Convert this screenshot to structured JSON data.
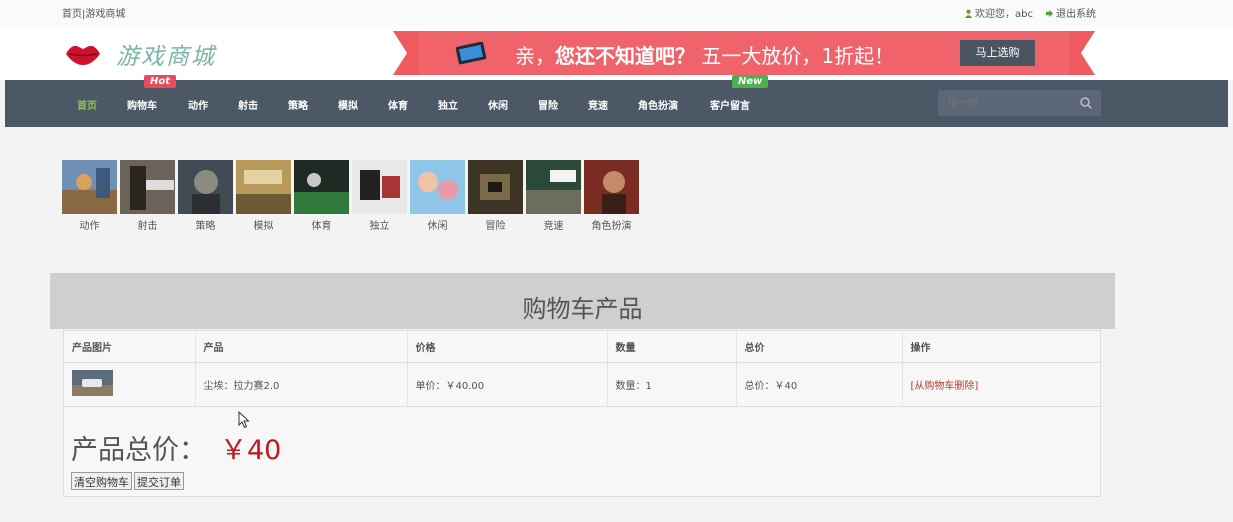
{
  "topbar": {
    "breadcrumb_home": "首页",
    "breadcrumb_sep": "|",
    "breadcrumb_current": "游戏商城",
    "welcome": "欢迎您，abc",
    "logout": "退出系统"
  },
  "header": {
    "logo_text": "游戏商城",
    "promo": {
      "text_prefix": "亲，",
      "text_bold": "您还不知道吧？",
      "text_rest": "五一大放价，1折起！",
      "button": "马上选购"
    }
  },
  "nav": {
    "items": [
      "首页",
      "购物车",
      "动作",
      "射击",
      "策略",
      "模拟",
      "体育",
      "独立",
      "休闲",
      "冒险",
      "竞速",
      "角色扮演",
      "客户留言"
    ],
    "active_index": 0,
    "badge_hot": "Hot",
    "badge_new": "New",
    "search_placeholder": "搜一搜"
  },
  "categories": [
    "动作",
    "射击",
    "策略",
    "模拟",
    "体育",
    "独立",
    "休闲",
    "冒险",
    "竞速",
    "角色扮演"
  ],
  "cart": {
    "title": "购物车产品",
    "headers": [
      "产品图片",
      "产品",
      "价格",
      "数量",
      "总价",
      "操作"
    ],
    "rows": [
      {
        "product": "尘埃：拉力赛2.0",
        "price": "单价：￥40.00",
        "quantity": "数量：1",
        "total": "总价：￥40",
        "action": "[从购物车删除]"
      }
    ],
    "total_label": "产品总价：",
    "total_value": "￥40",
    "clear_button": "清空购物车",
    "submit_button": "提交订单"
  },
  "colors": {
    "nav_bg": "#4d5867",
    "nav_active": "#8fc44f",
    "promo_red": "#f0636a",
    "badge_hot": "#e64c5b",
    "badge_new": "#4caf50",
    "price_red": "#c0191f"
  }
}
